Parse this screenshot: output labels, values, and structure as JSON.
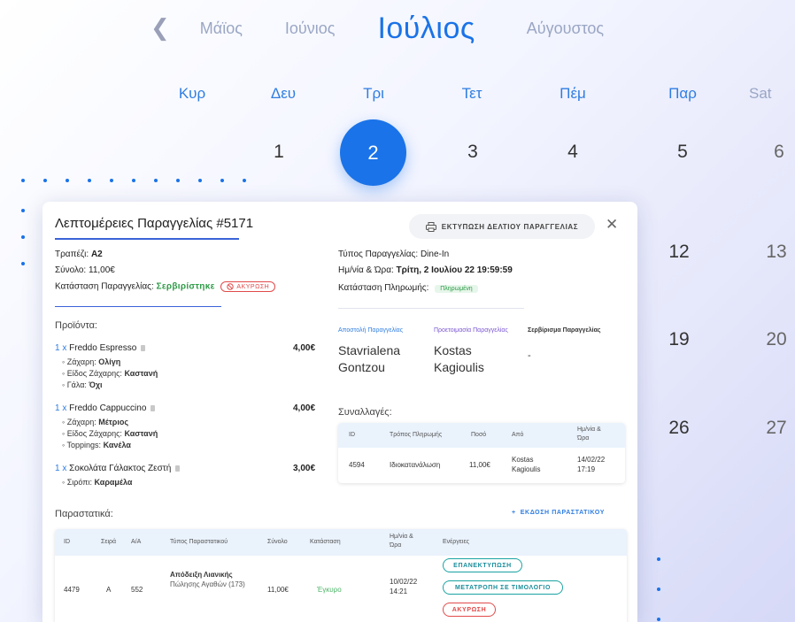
{
  "calendar": {
    "prev_icon": "chevron-left-icon",
    "months": [
      "Μάϊος",
      "Ιούνιος",
      "Ιούλιος",
      "Αύγουστος"
    ],
    "weekdays": [
      "Κυρ",
      "Δευ",
      "Τρι",
      "Τετ",
      "Πέμ",
      "Παρ",
      "Sat"
    ],
    "row1": [
      "1",
      "2",
      "3",
      "4",
      "5",
      "6"
    ],
    "right_days": [
      "12",
      "13",
      "19",
      "20",
      "26",
      "27"
    ],
    "accent": "#1a73e8"
  },
  "order": {
    "title": "Λεπτομέρειες Παραγγελίας #5171",
    "print_label": "ΕΚΤΥΠΩΣΗ ΔΕΛΤΙΟΥ ΠΑΡΑΓΓΕΛΙΑΣ",
    "close_icon": "close-icon",
    "table_label": "Τραπέζι:",
    "table_value": "A2",
    "total_label": "Σύνολο:",
    "total_value": "11,00€",
    "status_label": "Κατάσταση Παραγγελίας:",
    "status_value": "Σερβιρίστηκε",
    "cancel_label": "ΑΚΥΡΩΣΗ",
    "type_label": "Τύπος Παραγγελίας:",
    "type_value": "Dine-In",
    "datetime_label": "Ημ/νία & Ώρα:",
    "datetime_value": "Τρίτη, 2 Ιουλίου 22 19:59:59",
    "payment_label": "Κατάσταση Πληρωμής:",
    "payment_value": "Πληρωμένη"
  },
  "products": {
    "heading": "Προϊόντα:",
    "items": [
      {
        "qty": "1 x",
        "name": "Freddo Espresso",
        "price": "4,00€",
        "options": [
          [
            "Ζάχαρη:",
            "Ολίγη"
          ],
          [
            "Είδος Ζάχαρης:",
            "Καστανή"
          ],
          [
            "Γάλα:",
            "Όχι"
          ]
        ]
      },
      {
        "qty": "1 x",
        "name": "Freddo Cappuccino",
        "price": "4,00€",
        "options": [
          [
            "Ζάχαρη:",
            "Μέτριος"
          ],
          [
            "Είδος Ζάχαρης:",
            "Καστανή"
          ],
          [
            "Toppings:",
            "Κανέλα"
          ]
        ]
      },
      {
        "qty": "1 x",
        "name": "Σοκολάτα Γάλακτος Ζεστή",
        "price": "3,00€",
        "options": [
          [
            "Σιρόπι:",
            "Καραμέλα"
          ]
        ]
      }
    ]
  },
  "people": [
    {
      "label": "Αποστολή Παραγγελίας",
      "name": "Stavrialena Gontzou",
      "color": "#2f7de1"
    },
    {
      "label": "Προετοιμασία Παραγγελίας",
      "name": "Kostas Kagioulis",
      "color": "#7b57d1"
    },
    {
      "label": "Σερβίρισμα Παραγγελίας",
      "name": "-",
      "color": "#333333"
    }
  ],
  "transactions": {
    "heading": "Συναλλαγές:",
    "headers": [
      "ID",
      "Τρόπος Πληρωμής",
      "Ποσό",
      "Από",
      "Ημ/νία & Ώρα"
    ],
    "rows": [
      [
        "4594",
        "Ιδιοκατανάλωση",
        "11,00€",
        "Kostas Kagioulis",
        "14/02/22 17:19"
      ]
    ]
  },
  "documents": {
    "heading": "Παραστατικά:",
    "add_label": "ΕΚΔΟΣΗ ΠΑΡΑΣΤΑΤΙΚΟΥ",
    "headers": [
      "ID",
      "Σειρά",
      "Α/Α",
      "Τύπος Παραστατικού",
      "Σύνολο",
      "Κατάσταση",
      "Ημ/νία & Ώρα",
      "Ενέργειες"
    ],
    "row": {
      "id": "4479",
      "series": "A",
      "aa": "552",
      "type_bold": "Απόδειξη Λιανικής",
      "type_rest": "Πώλησης Αγαθών (173)",
      "total": "11,00€",
      "status": "Έγκυρο",
      "datetime": "10/02/22 14:21"
    },
    "actions": [
      "ΕΠΑΝΕΚΤΥΠΩΣΗ",
      "ΜΕΤΑΤΡΟΠΗ ΣΕ ΤΙΜΟΛΟΓΙΟ",
      "ΑΚΥΡΩΣΗ"
    ]
  }
}
